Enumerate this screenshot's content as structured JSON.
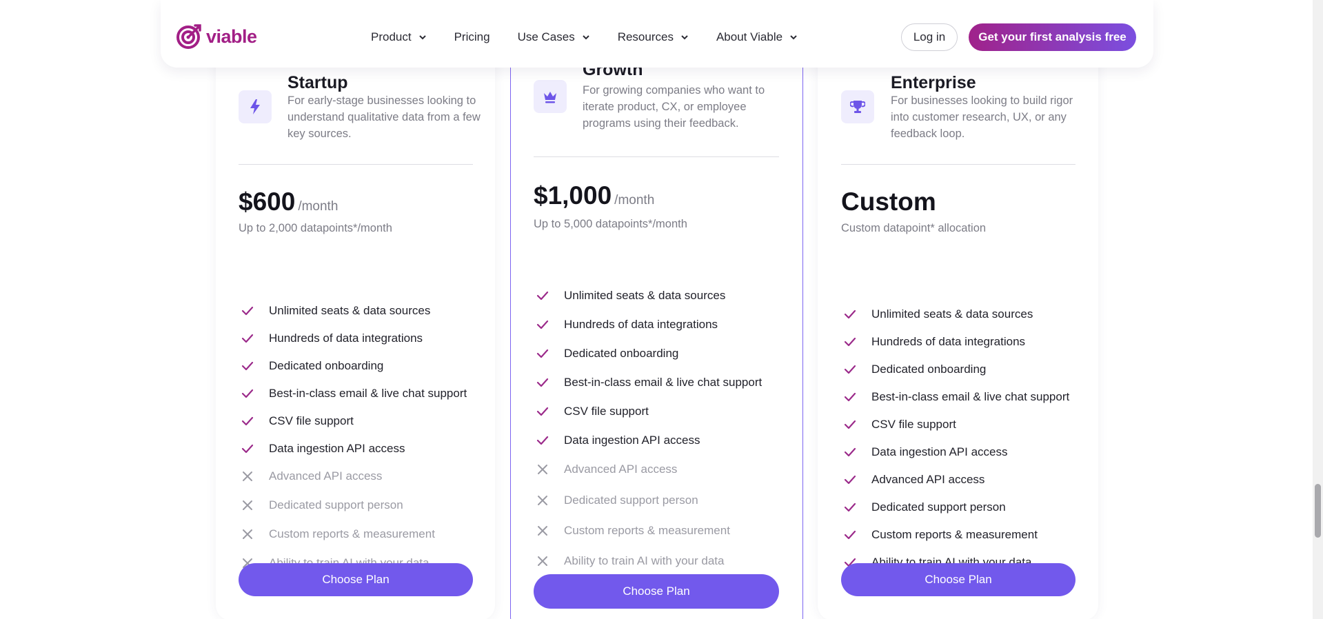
{
  "nav": {
    "logo_text": "viable",
    "items": [
      {
        "label": "Product",
        "has_dropdown": true
      },
      {
        "label": "Pricing",
        "has_dropdown": false
      },
      {
        "label": "Use Cases",
        "has_dropdown": true
      },
      {
        "label": "Resources",
        "has_dropdown": true
      },
      {
        "label": "About Viable",
        "has_dropdown": true
      }
    ],
    "login_label": "Log in",
    "cta_label": "Get your first analysis free"
  },
  "colors": {
    "brand": "#a21f86",
    "accent": "#7259ec",
    "check": "#9b2a8a",
    "cross": "#9a9aa3"
  },
  "plans": [
    {
      "name": "Startup",
      "icon": "lightning-icon",
      "description": "For early-stage businesses looking to understand qualitative data from a few key sources.",
      "price": "$600",
      "period": "/month",
      "quota": "Up to 2,000 datapoints*/month",
      "button": "Choose Plan",
      "features": [
        {
          "label": "Unlimited seats & data sources",
          "included": true
        },
        {
          "label": "Hundreds of data integrations",
          "included": true
        },
        {
          "label": "Dedicated onboarding",
          "included": true
        },
        {
          "label": "Best-in-class email & live chat support",
          "included": true
        },
        {
          "label": "CSV file support",
          "included": true
        },
        {
          "label": "Data ingestion API access",
          "included": true
        },
        {
          "label": "Advanced API access",
          "included": false
        },
        {
          "label": "Dedicated support person",
          "included": false
        },
        {
          "label": "Custom reports & measurement",
          "included": false
        },
        {
          "label": "Ability to train AI with your data",
          "included": false
        }
      ]
    },
    {
      "name": "Growth",
      "icon": "crown-icon",
      "description": "For growing companies who want to iterate product, CX, or employee programs using their feedback.",
      "price": "$1,000",
      "period": "/month",
      "quota": "Up to 5,000 datapoints*/month",
      "button": "Choose Plan",
      "features": [
        {
          "label": "Unlimited seats & data sources",
          "included": true
        },
        {
          "label": "Hundreds of data integrations",
          "included": true
        },
        {
          "label": "Dedicated onboarding",
          "included": true
        },
        {
          "label": "Best-in-class email & live chat support",
          "included": true
        },
        {
          "label": "CSV file support",
          "included": true
        },
        {
          "label": "Data ingestion API access",
          "included": true
        },
        {
          "label": "Advanced API access",
          "included": false
        },
        {
          "label": "Dedicated support person",
          "included": false
        },
        {
          "label": "Custom reports & measurement",
          "included": false
        },
        {
          "label": "Ability to train AI with your data",
          "included": false
        }
      ]
    },
    {
      "name": "Enterprise",
      "icon": "trophy-icon",
      "description": "For businesses looking to build rigor into customer research, UX, or any feedback loop.",
      "price": "Custom",
      "period": "",
      "quota": "Custom datapoint* allocation",
      "button": "Choose Plan",
      "features": [
        {
          "label": "Unlimited seats & data sources",
          "included": true
        },
        {
          "label": "Hundreds of data integrations",
          "included": true
        },
        {
          "label": "Dedicated onboarding",
          "included": true
        },
        {
          "label": "Best-in-class email & live chat support",
          "included": true
        },
        {
          "label": "CSV file support",
          "included": true
        },
        {
          "label": "Data ingestion API access",
          "included": true
        },
        {
          "label": "Advanced API access",
          "included": true
        },
        {
          "label": "Dedicated support person",
          "included": true
        },
        {
          "label": "Custom reports & measurement",
          "included": true
        },
        {
          "label": "Ability to train AI with your data",
          "included": true
        }
      ]
    }
  ]
}
